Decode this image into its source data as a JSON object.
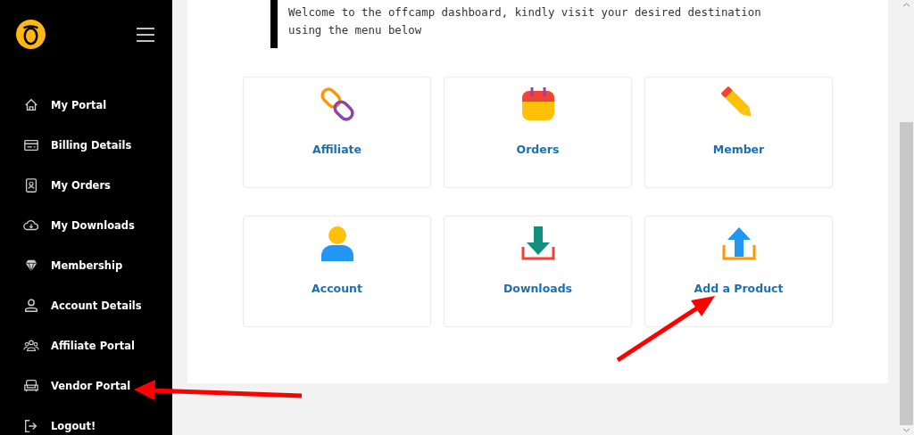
{
  "sidebar": {
    "items": [
      {
        "label": "My Portal"
      },
      {
        "label": "Billing Details"
      },
      {
        "label": "My Orders"
      },
      {
        "label": "My Downloads"
      },
      {
        "label": "Membership"
      },
      {
        "label": "Account Details"
      },
      {
        "label": "Affiliate Portal"
      },
      {
        "label": "Vendor Portal"
      },
      {
        "label": "Logout!"
      }
    ]
  },
  "welcome": "Welcome to the offcamp dashboard, kindly visit your desired destination using the menu below",
  "cards": [
    {
      "label": "Affiliate"
    },
    {
      "label": "Orders"
    },
    {
      "label": "Member"
    },
    {
      "label": "Account"
    },
    {
      "label": "Downloads"
    },
    {
      "label": "Add a Product"
    }
  ]
}
